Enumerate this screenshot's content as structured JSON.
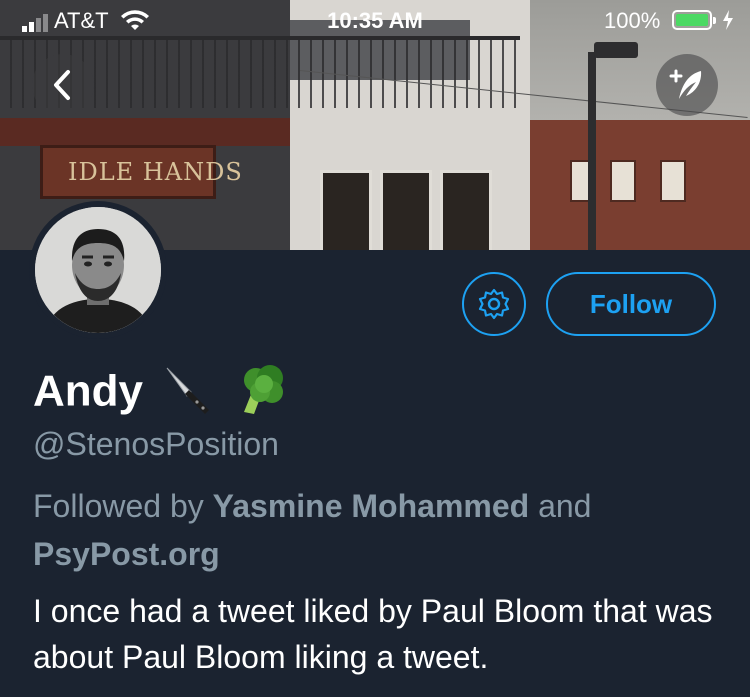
{
  "status_bar": {
    "carrier": "AT&T",
    "time": "10:35 AM",
    "battery_percent": "100%",
    "battery_level": 1.0,
    "charging": true
  },
  "header": {
    "storefront_sign": "IDLE HANDS",
    "back_icon": "chevron-left-icon",
    "compose_icon": "compose-tweet-icon"
  },
  "profile": {
    "name": "Andy",
    "name_emoji": [
      "knife-emoji",
      "broccoli-emoji"
    ],
    "handle": "@StenosPosition",
    "followed_by_prefix": "Followed by",
    "followed_by_user_1": "Yasmine Mohammed",
    "followed_by_and": "and",
    "followed_by_user_2": "PsyPost.org",
    "bio": "I once had a tweet liked by Paul Bloom that was about Paul Bloom liking a tweet."
  },
  "actions": {
    "settings_icon": "gear-icon",
    "follow_label": "Follow"
  },
  "colors": {
    "background": "#1b2330",
    "accent": "#1da1f2",
    "secondary_text": "#8899a6"
  }
}
